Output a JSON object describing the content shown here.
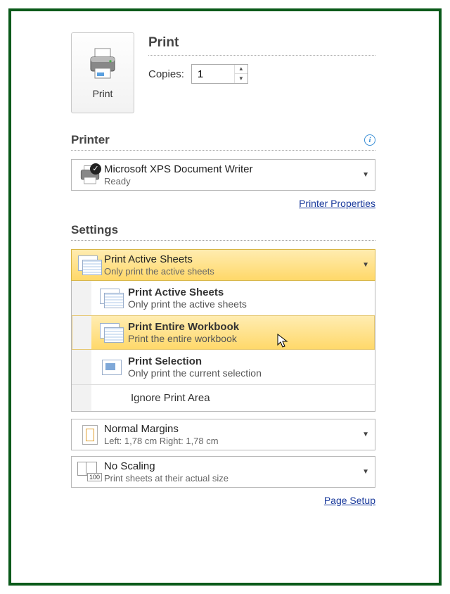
{
  "print": {
    "heading": "Print",
    "button_label": "Print",
    "copies_label": "Copies:",
    "copies_value": "1"
  },
  "printer": {
    "heading": "Printer",
    "name": "Microsoft XPS Document Writer",
    "status": "Ready",
    "properties_link": "Printer Properties"
  },
  "settings": {
    "heading": "Settings",
    "selected": {
      "title": "Print Active Sheets",
      "sub": "Only print the active sheets"
    },
    "options": [
      {
        "title": "Print Active Sheets",
        "sub": "Only print the active sheets"
      },
      {
        "title": "Print Entire Workbook",
        "sub": "Print the entire workbook"
      },
      {
        "title": "Print Selection",
        "sub": "Only print the current selection"
      }
    ],
    "ignore_area": "Ignore Print Area",
    "margins": {
      "title": "Normal Margins",
      "sub": "Left: 1,78 cm   Right: 1,78 cm"
    },
    "scaling": {
      "title": "No Scaling",
      "sub": "Print sheets at their actual size",
      "badge": "100"
    },
    "page_setup_link": "Page Setup"
  }
}
